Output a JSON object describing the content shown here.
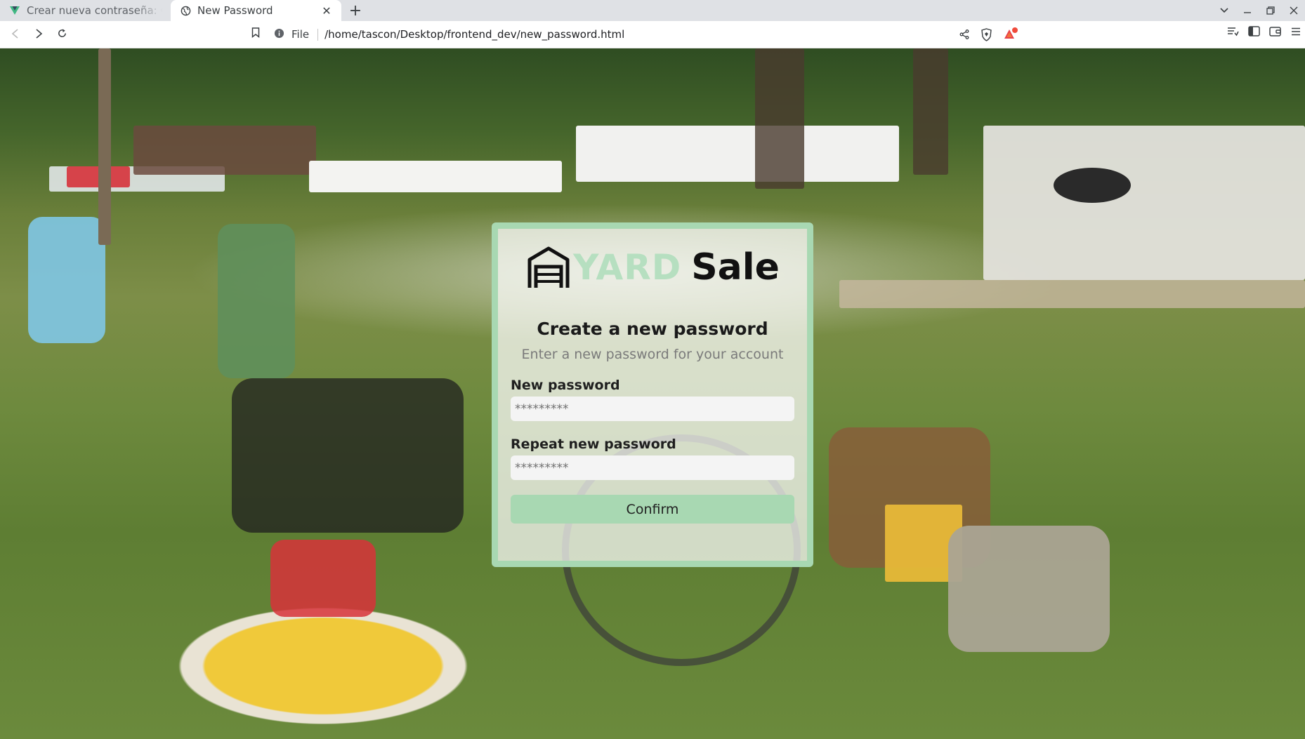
{
  "browser": {
    "tabs": [
      {
        "title": "Crear nueva contraseña: CSS",
        "active": false
      },
      {
        "title": "New Password",
        "active": true
      }
    ],
    "new_tab_icon": "plus-icon",
    "address_bar": {
      "scheme_label": "File",
      "url": "/home/tascon/Desktop/frontend_dev/new_password.html"
    },
    "window_controls": [
      "chevron-down-icon",
      "minimize-icon",
      "restore-icon",
      "close-icon"
    ]
  },
  "page": {
    "logo": {
      "word_1": "YARD",
      "word_2": "Sale"
    },
    "title": "Create a new password",
    "subtitle": "Enter a new password for your account",
    "fields": [
      {
        "label": "New password",
        "placeholder": "*********"
      },
      {
        "label": "Repeat new password",
        "placeholder": "*********"
      }
    ],
    "confirm_label": "Confirm"
  },
  "colors": {
    "accent": "#a8d8b2",
    "card_background": "#ffffffb8",
    "brand_light": "#b6dfc0"
  }
}
